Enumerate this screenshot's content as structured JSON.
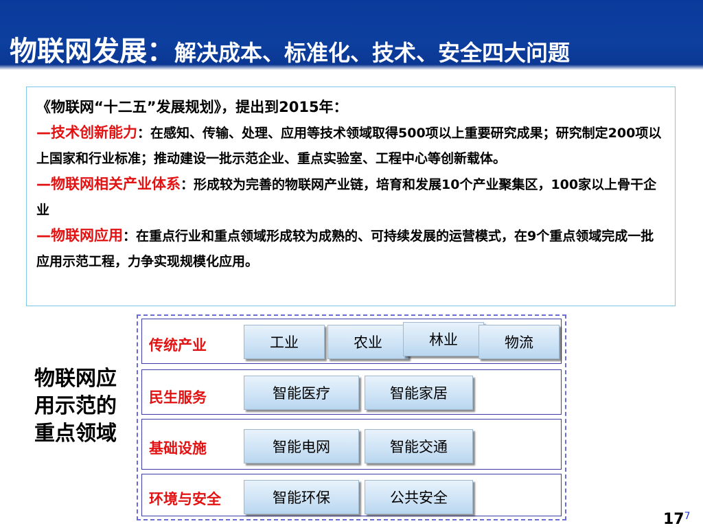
{
  "title": {
    "main": "物联网发展：",
    "sub": "解决成本、标准化、技术、安全四大问题"
  },
  "textbox": {
    "intro": "《物联网“十二五”发展规划》，提出到2015年：",
    "items": [
      {
        "heading": "—技术创新能力",
        "body": "：在感知、传输、处理、应用等技术领域取得500项以上重要研究成果；研究制定200项以上国家和行业标准；推动建设一批示范企业、重点实验室、工程中心等创新载体。"
      },
      {
        "heading": "—物联网相关产业体系",
        "body": "：形成较为完善的物联网产业链，培育和发展10个产业聚集区，100家以上骨干企业"
      },
      {
        "heading": "—物联网应用",
        "body": "：在重点行业和重点领域形成较为成熟的、可持续发展的运营模式，在9个重点领域完成一批应用示范工程，力争实现规模化应用。"
      }
    ]
  },
  "side_label": "物联网应用示范的重点领域",
  "rows": [
    {
      "label": "传统产业",
      "buttons": [
        "工业",
        "农业",
        "林业",
        "物流"
      ]
    },
    {
      "label": "民生服务",
      "buttons": [
        "智能医疗",
        "智能家居"
      ]
    },
    {
      "label": "基础设施",
      "buttons": [
        "智能电网",
        "智能交通"
      ]
    },
    {
      "label": "环境与安全",
      "buttons": [
        "智能环保",
        "公共安全"
      ]
    }
  ],
  "page_number": "17",
  "page_number_sup": "7",
  "colors": {
    "title_bg": "#0d3f9f",
    "highlight": "#e31212",
    "frame": "#6b6bd8"
  }
}
